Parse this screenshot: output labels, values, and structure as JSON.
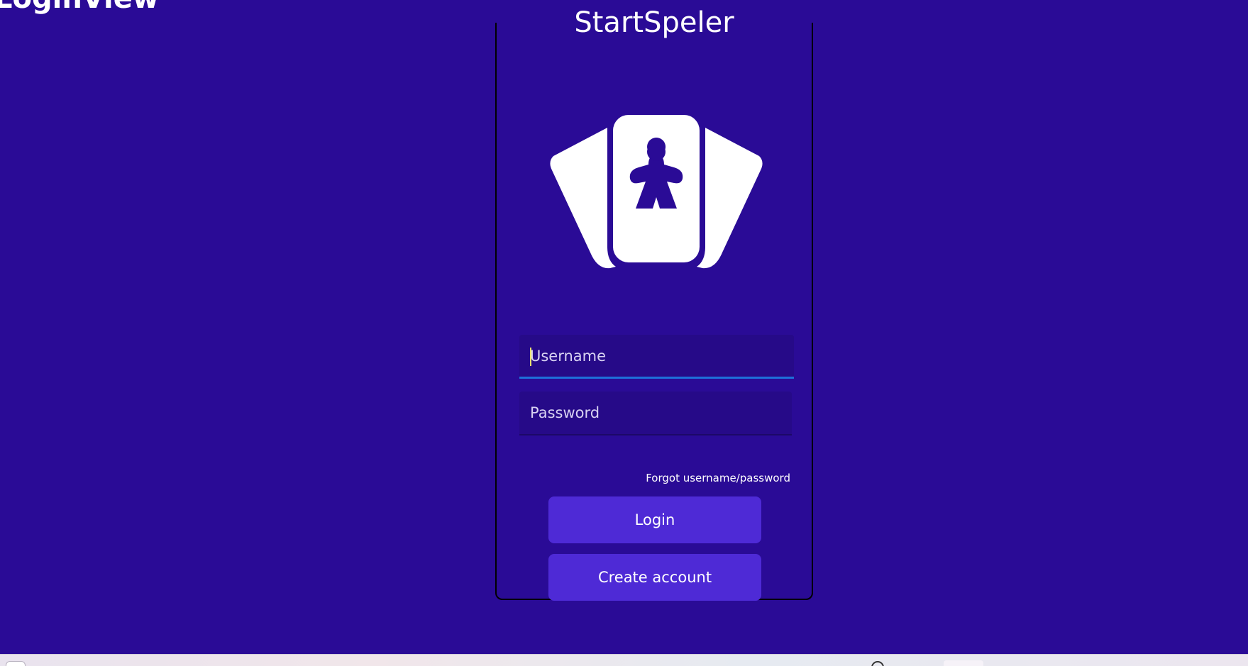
{
  "window": {
    "view_title": "LoginView"
  },
  "card": {
    "app_title": "StartSpeler",
    "logo_icon": "card-fan-meeple-icon"
  },
  "form": {
    "username_placeholder": "Username",
    "username_value": "",
    "password_placeholder": "Password",
    "password_value": "",
    "forgot_link": "Forgot username/password",
    "login_button": "Login",
    "create_account_button": "Create account"
  },
  "colors": {
    "background": "#2a0b96",
    "button": "#4e2ad6",
    "focus_underline": "#1e6fd9",
    "text": "#ffffff"
  }
}
